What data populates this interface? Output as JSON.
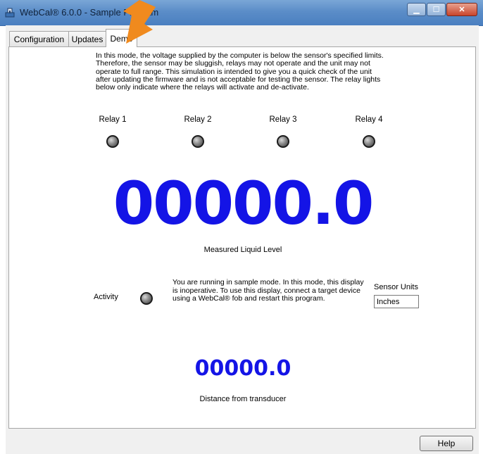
{
  "window": {
    "title": "WebCal® 6.0.0 - Sample Program",
    "app_icon": "webcal-app-icon",
    "controls": {
      "minimize": "minimize-icon",
      "maximize": "maximize-icon",
      "close": "close-icon"
    }
  },
  "tabs": [
    {
      "label": "Configuration",
      "active": false
    },
    {
      "label": "Updates",
      "active": false
    },
    {
      "label": "Demo",
      "active": true
    }
  ],
  "demo": {
    "info": "In this mode, the voltage supplied by the computer is below the sensor's specified limits. Therefore, the sensor may be sluggish, relays may not operate and the unit may not operate to full range. This simulation is intended to give you a quick check of the unit after updating the firmware and is not acceptable for testing the sensor. The relay lights below only indicate where the relays will activate and de-activate.",
    "relays": [
      {
        "label": "Relay 1",
        "on": false
      },
      {
        "label": "Relay 2",
        "on": false
      },
      {
        "label": "Relay 3",
        "on": false
      },
      {
        "label": "Relay 4",
        "on": false
      }
    ],
    "level_value": "00000.0",
    "level_caption": "Measured Liquid Level",
    "activity_label": "Activity",
    "sample_note": "You are running in sample mode. In this mode, this display is inoperative. To use this display, connect a target device using a WebCal® fob and restart this program.",
    "units_label": "Sensor Units",
    "units_value": "Inches",
    "distance_value": "00000.0",
    "distance_caption": "Distance from transducer"
  },
  "footer": {
    "help_label": "Help"
  },
  "colors": {
    "readout": "#1414e6",
    "arrow": "#f08a1e"
  }
}
